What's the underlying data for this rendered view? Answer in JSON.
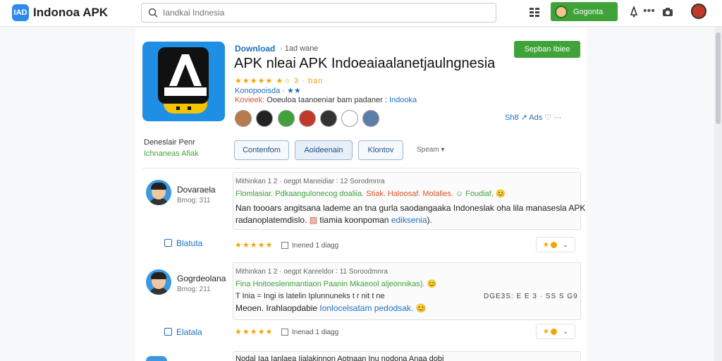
{
  "header": {
    "logo_text": "IAD",
    "brand": "Indonoa APK",
    "search_placeholder": "Iandkai Indnesia",
    "user_button": "Gogonta"
  },
  "app": {
    "download_label": "Download",
    "download_sub": "· 1ad wane",
    "install_button": "Sepban Ibiee",
    "title": "APK nleai APK Indoeaiaalanetjaulngnesia",
    "rating_text": "★★★★★  ★☆ 3 · ban",
    "tag_line": "Konopooisda · ★★",
    "desc_label": "Kovieek:",
    "desc_text": "Ooeuloa Iaanoeniar bam padaner :",
    "desc_link": "Indooka",
    "share_text": "Sh8  ↗  Ads  ♡     ···"
  },
  "sidebar": {
    "label1": "Deneslair Penr",
    "label2": "Ichnaneas Afiak"
  },
  "tabs": [
    {
      "label": "Contenfom"
    },
    {
      "label": "Aoideenain"
    },
    {
      "label": "Klontov"
    }
  ],
  "sort_label": "Speam ▾",
  "reviews": [
    {
      "name": "Dovaraela",
      "date": "Bmog: 311",
      "link": "Blatuta",
      "meta": "Mithinkan 1 2 · oegpt  Maneidiar  ∶ 12  Sorodmnra",
      "tags_green": "Flomlasiar. Pdkaangulonecog doaliia. ",
      "tags_red": "Stiak. Haloosaf. Molalles. ",
      "tags_green2": "☺ Foudiaf,",
      "tags_emoji": " 😊",
      "text1": "Nan toooars angitsana lademe an tna gurla saodangaaka Indoneslak oha lila manasesla APK",
      "text2_a": "radanoplatemdislo. ",
      "text2_red": "▧",
      "text2_b": " tiamia koonpoman ",
      "text2_link": "ediksenia",
      "text2_c": ").",
      "helpful": "Inened 1 diagg"
    },
    {
      "name": "Gogrdeolana",
      "date": "Bmog: 211",
      "link": "Elatala",
      "meta": "Mithinkan 1 2 · oegpt  Kareeldor  ∶ 11  Soroodmnra",
      "tags_green": "Fina  Hnitoeslenmantiaon  Paanin  Mkaeool  aljeonnikas). 😊",
      "tags_dark": "T  Inia  =  Ingi  is  latelin  Iplunnuneks  t  r  nit  t  ne",
      "right_code": "DGE3S: E  E  3 · SS  S  G9",
      "text1": "Meoen. Irahlaopdabie ",
      "text1_link": "Ionlocelsatam pedodsak.",
      "text1_emoji": " 😊",
      "helpful": "Inenad 1 diagg"
    }
  ],
  "partial_review": {
    "text": "Nodal  Iaa  Ianlaea  Iialakinnon  Aotnaan  Inu  nodona  Anaa  dobi"
  },
  "colors": {
    "accent_green": "#3fa33a",
    "link_blue": "#1e6fc0",
    "star_orange": "#f0a500",
    "app_icon_blue": "#1f8fe6"
  },
  "icons": [
    "search-icon",
    "grid-icon",
    "bell-icon",
    "more-icon",
    "camera-icon",
    "share-icon",
    "heart-icon",
    "calendar-icon",
    "chevron-down-icon"
  ]
}
